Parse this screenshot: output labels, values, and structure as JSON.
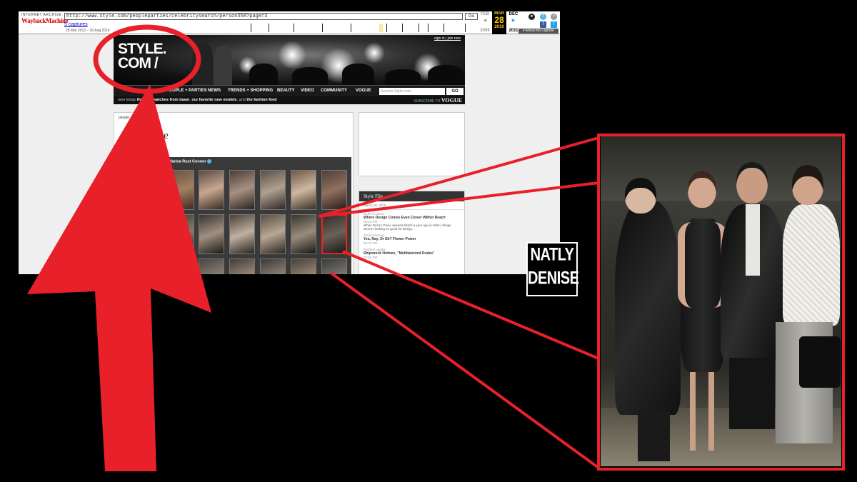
{
  "wayback": {
    "logo_top": "INTERNET ARCHIVE",
    "logo_name": "WaybackMachine",
    "url": "http://www.style.com/peopleparties/celebritysearch/person558?page=3",
    "go_label": "Go",
    "captures": "5 captures",
    "capture_range": "28 Mar 2012 – 30 Aug 2014",
    "prev_month": "FEB",
    "cur_month": "MAR",
    "cur_day": "28",
    "cur_year": "2010",
    "next_month": "DEC",
    "prev_year": "2009",
    "next_year": "2011",
    "about": "▾ About this capture"
  },
  "site": {
    "signin": "sign in | join now",
    "logo_line1": "STYLE.",
    "logo_line2": "COM /",
    "nav": {
      "people": "PEOPLE + PARTIES",
      "news": "NEWS",
      "trends": "TRENDS + SHOPPING",
      "beauty": "BEAUTY",
      "video": "VIDEO",
      "community": "COMMUNITY",
      "vogue": "VOGUE"
    },
    "search_placeholder": "Search Style.com",
    "search_go": "GO",
    "ticker_prefix": "new today",
    "ticker_1": "the best watches from basel",
    "ticker_sep1": ", ",
    "ticker_2": "our favorite new models",
    "ticker_sep2": ", and ",
    "ticker_3": "the fashion feed",
    "subscribe": "SUBSCRIBE TO",
    "subscribe_brand": "VOGUE",
    "breadcrumb": "people · s",
    "page_title": "rowse",
    "section": "MODELS",
    "grid_title": "Marina Rust Connor",
    "stylefile": {
      "header": "Style File",
      "date": "March 28, 2010",
      "items": [
        {
          "cat": "Stuff of culture",
          "title": "Where Design Comes Even Closer Within Reach",
          "time": "05:03 PM",
          "excerpt": "When Renzo Piano opened Skitch a year ago in Milan, things weren't looking so good for design..."
        },
        {
          "cat": "Trend tracking",
          "title": "Yea, Nay, Or Eh? Flower Power",
          "time": "04:23 PM",
          "excerpt": ""
        },
        {
          "cat": "Fashion update",
          "title": "Shipwreck Holmes, \"Multitalented Dudes\"",
          "time": "03:50 PM",
          "excerpt": ""
        }
      ]
    }
  },
  "badge": {
    "line1": "NATLY",
    "line2": "DENISE"
  },
  "colors": {
    "annotation_red": "#e8202a",
    "page_bg": "#000000"
  }
}
